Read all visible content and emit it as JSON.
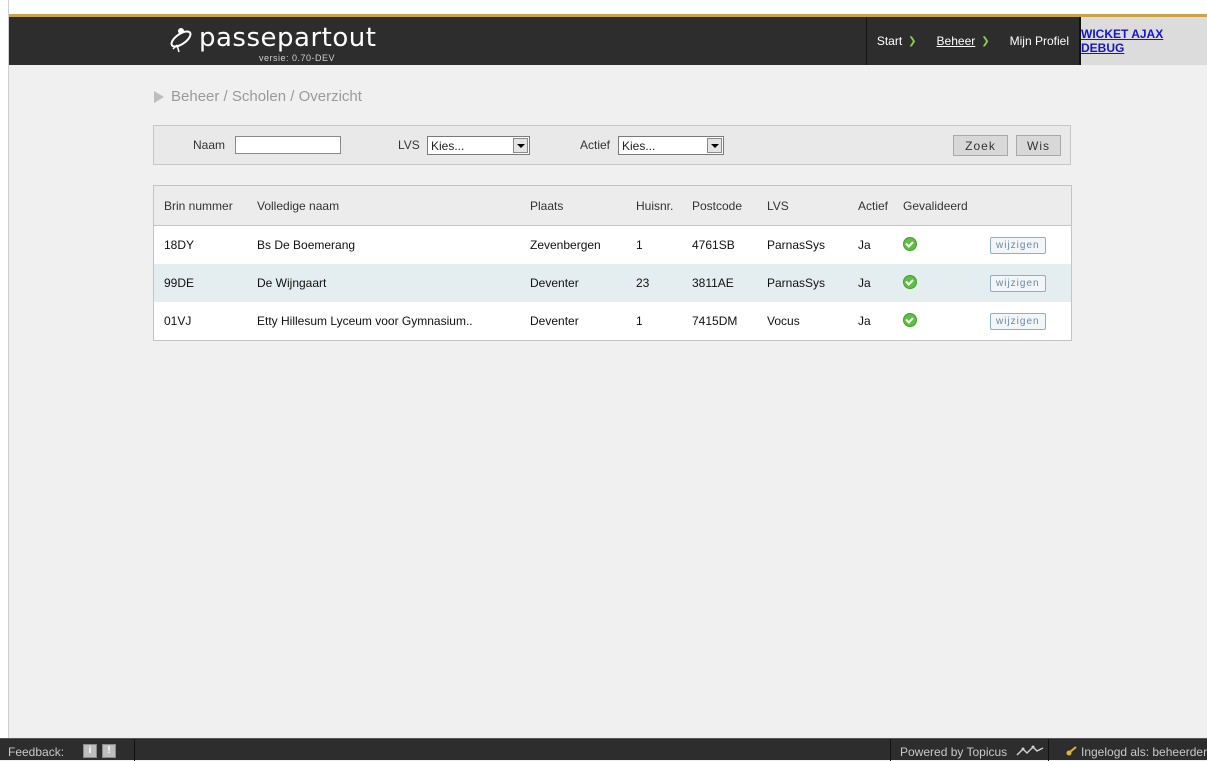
{
  "header": {
    "logo_name": "passepartout",
    "logo_version": "versie: 0.70-DEV",
    "nav": {
      "start": "Start",
      "beheer": "Beheer",
      "profiel": "Mijn Profiel",
      "debug": "WICKET AJAX DEBUG"
    },
    "accent_color": "#8dcf4a"
  },
  "breadcrumb": "Beheer / Scholen / Overzicht",
  "filter": {
    "naam_label": "Naam",
    "naam_value": "",
    "lvs_label": "LVS",
    "lvs_selected": "Kies...",
    "actief_label": "Actief",
    "actief_selected": "Kies...",
    "zoek_label": "Zoek",
    "wis_label": "Wis"
  },
  "table": {
    "columns": [
      "Brin nummer",
      "Volledige naam",
      "Plaats",
      "Huisnr.",
      "Postcode",
      "LVS",
      "Actief",
      "Gevalideerd"
    ],
    "rows": [
      {
        "brin": "18DY",
        "naam": "Bs De Boemerang",
        "plaats": "Zevenbergen",
        "huisnr": "1",
        "postcode": "4761SB",
        "lvs": "ParnasSys",
        "actief": "Ja",
        "gevalideerd_icon": "check-circle-icon",
        "action": "wijzigen"
      },
      {
        "brin": "99DE",
        "naam": "De Wijngaart",
        "plaats": "Deventer",
        "huisnr": "23",
        "postcode": "3811AE",
        "lvs": "ParnasSys",
        "actief": "Ja",
        "gevalideerd_icon": "check-circle-icon",
        "action": "wijzigen"
      },
      {
        "brin": "01VJ",
        "naam": "Etty Hillesum Lyceum voor Gymnasium..",
        "plaats": "Deventer",
        "huisnr": "1",
        "postcode": "7415DM",
        "lvs": "Vocus",
        "actief": "Ja",
        "gevalideerd_icon": "check-circle-icon",
        "action": "wijzigen"
      }
    ]
  },
  "footer": {
    "feedback": "Feedback:",
    "info_icon": "i",
    "alert_icon": "!",
    "powered": "Powered by Topicus",
    "logged_in": "Ingelogd als: beheerder"
  }
}
